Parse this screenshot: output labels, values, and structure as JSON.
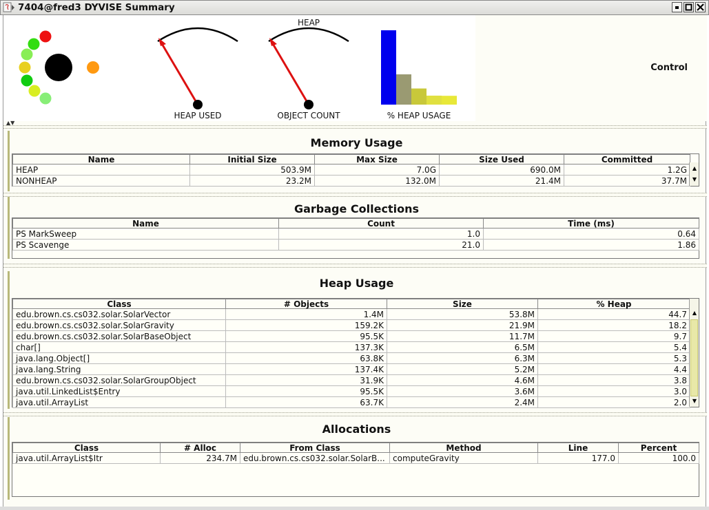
{
  "window": {
    "title": "7404@fred3 DYVISE Summary"
  },
  "gauges": {
    "heap_used_label": "HEAP USED",
    "object_count_label": "OBJECT COUNT",
    "heap_title": "HEAP",
    "heap_usage_label": "% HEAP USAGE",
    "control_label": "Control"
  },
  "colors": {
    "accent_blue": "#0000ee",
    "needle_red": "#dd1111",
    "panel_border": "#b8b87a"
  },
  "memory": {
    "title": "Memory Usage",
    "headers": [
      "Name",
      "Initial Size",
      "Max Size",
      "Size Used",
      "Committed"
    ],
    "rows": [
      [
        "HEAP",
        "503.9M",
        "7.0G",
        "690.0M",
        "1.2G"
      ],
      [
        "NONHEAP",
        "23.2M",
        "132.0M",
        "21.4M",
        "37.7M"
      ]
    ]
  },
  "gc": {
    "title": "Garbage Collections",
    "headers": [
      "Name",
      "Count",
      "Time (ms)"
    ],
    "rows": [
      [
        "PS MarkSweep",
        "1.0",
        "0.64"
      ],
      [
        "PS Scavenge",
        "21.0",
        "1.86"
      ]
    ]
  },
  "heap": {
    "title": "Heap Usage",
    "headers": [
      "Class",
      "# Objects",
      "Size",
      "% Heap"
    ],
    "rows": [
      [
        "edu.brown.cs.cs032.solar.SolarVector",
        "1.4M",
        "53.8M",
        "44.7"
      ],
      [
        "edu.brown.cs.cs032.solar.SolarGravity",
        "159.2K",
        "21.9M",
        "18.2"
      ],
      [
        "edu.brown.cs.cs032.solar.SolarBaseObject",
        "95.5K",
        "11.7M",
        "9.7"
      ],
      [
        "char[]",
        "137.3K",
        "6.5M",
        "5.4"
      ],
      [
        "java.lang.Object[]",
        "63.8K",
        "6.3M",
        "5.3"
      ],
      [
        "java.lang.String",
        "137.4K",
        "5.2M",
        "4.4"
      ],
      [
        "edu.brown.cs.cs032.solar.SolarGroupObject",
        "31.9K",
        "4.6M",
        "3.8"
      ],
      [
        "java.util.LinkedList$Entry",
        "95.5K",
        "3.6M",
        "3.0"
      ],
      [
        "java.util.ArrayList",
        "63.7K",
        "2.4M",
        "2.0"
      ]
    ]
  },
  "alloc": {
    "title": "Allocations",
    "headers": [
      "Class",
      "# Alloc",
      "From Class",
      "Method",
      "Line",
      "Percent"
    ],
    "rows": [
      [
        "java.util.ArrayList$Itr",
        "234.7M",
        "edu.brown.cs.cs032.solar.SolarB...",
        "computeGravity",
        "177.0",
        "100.0"
      ]
    ]
  },
  "chart_data": {
    "type": "bar",
    "title": "% HEAP USAGE",
    "values": [
      44.7,
      18.2,
      9.7,
      5.4,
      5.3
    ],
    "colors": [
      "#0000ee",
      "#9a9a72",
      "#c8c83a",
      "#e0e040",
      "#e8e838"
    ]
  }
}
